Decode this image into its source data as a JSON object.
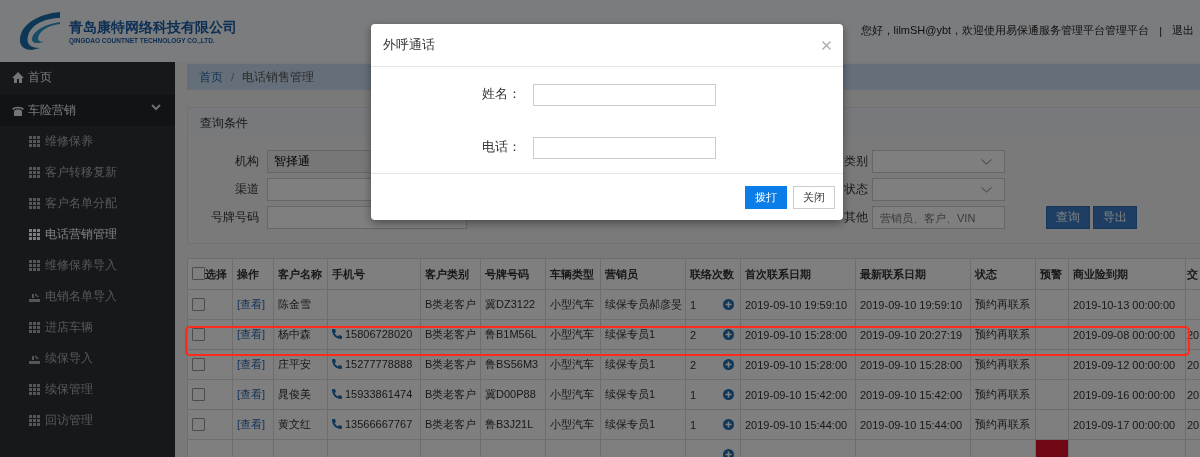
{
  "header": {
    "company_name": "青岛康特网络科技有限公司",
    "company_subtitle": "QINGDAO COUNTNET TECHNOLOGY CO.,LTD.",
    "greeting": "您好，lilmSH@ybt，欢迎使用易保通服务管理平台管理平台",
    "separator": "|",
    "logout": "退出"
  },
  "sidebar": {
    "items": [
      {
        "label": "首页",
        "kind": "home",
        "expanded": false
      },
      {
        "label": "车险营销",
        "kind": "phone",
        "expanded": true,
        "children": [
          {
            "label": "维修保养",
            "kind": "page",
            "selected": false
          },
          {
            "label": "客户转移复新",
            "kind": "page",
            "selected": false
          },
          {
            "label": "客户名单分配",
            "kind": "page",
            "selected": false
          },
          {
            "label": "电话营销管理",
            "kind": "page",
            "selected": true
          },
          {
            "label": "维修保养导入",
            "kind": "page",
            "selected": false
          },
          {
            "label": "电销名单导入",
            "kind": "upload",
            "selected": false
          },
          {
            "label": "进店车辆",
            "kind": "page",
            "selected": false
          },
          {
            "label": "续保导入",
            "kind": "upload",
            "selected": false
          },
          {
            "label": "续保管理",
            "kind": "page",
            "selected": false
          },
          {
            "label": "回访管理",
            "kind": "page",
            "selected": false
          }
        ]
      }
    ]
  },
  "breadcrumb": [
    {
      "label": "首页",
      "kind": "link"
    },
    {
      "label": "/",
      "kind": "separator"
    },
    {
      "label": "电话销售管理",
      "kind": "current"
    }
  ],
  "query_panel": {
    "title": "查询条件",
    "left_fields": [
      {
        "label": "机构",
        "value": "智择通"
      },
      {
        "label": "渠道"
      },
      {
        "label": "号牌号码"
      }
    ],
    "right_fields": [
      {
        "label": "类别",
        "kind": "select"
      },
      {
        "label": "状态",
        "kind": "select"
      },
      {
        "label": "其他",
        "kind": "input",
        "placeholder": "营销员、客户、VIN"
      }
    ],
    "buttons": [
      "查询",
      "导出"
    ]
  },
  "table": {
    "columns": [
      "选择",
      "操作",
      "客户名称",
      "手机号",
      "客户类别",
      "号牌号码",
      "车辆类型",
      "营销员",
      "联络次数",
      "首次联系日期",
      "最新联系日期",
      "状态",
      "预警",
      "商业险到期",
      "交"
    ],
    "rows": [
      {
        "checked": false,
        "highlighted": false,
        "warning": false,
        "action": "[查看]",
        "name": "陈金雪",
        "customer_type": "B类老客户",
        "plate": "冀DZ3122",
        "vehicle_type": "小型汽车",
        "salesperson": "续保专员郝彦旻",
        "contacts": "1",
        "first_contact": "2019-09-10 19:59:10",
        "last_contact": "2019-09-10 19:59:10",
        "status": "预约再联系",
        "insurance_expiry": "2019-10-13 00:00:00"
      },
      {
        "checked": false,
        "highlighted": true,
        "warning": false,
        "action": "[查看]",
        "name": "杨中森",
        "phone": "15806728020",
        "customer_type": "B类老客户",
        "plate": "鲁B1M56L",
        "vehicle_type": "小型汽车",
        "salesperson": "续保专员1",
        "contacts": "2",
        "first_contact": "2019-09-10 15:28:00",
        "last_contact": "2019-09-10 20:27:19",
        "status": "预约再联系",
        "insurance_expiry": "2019-09-08 00:00:00",
        "column_15": "20"
      },
      {
        "checked": false,
        "highlighted": false,
        "warning": false,
        "action": "[查看]",
        "name": "庄平安",
        "phone": "15277778888",
        "customer_type": "B类老客户",
        "plate": "鲁BS56M3",
        "vehicle_type": "小型汽车",
        "salesperson": "续保专员1",
        "contacts": "2",
        "first_contact": "2019-09-10 15:28:00",
        "last_contact": "2019-09-10 15:28:00",
        "status": "预约再联系",
        "insurance_expiry": "2019-09-12 00:00:00",
        "column_15": "20"
      },
      {
        "checked": false,
        "highlighted": false,
        "warning": false,
        "action": "[查看]",
        "name": "晁俊美",
        "phone": "15933861474",
        "customer_type": "B类老客户",
        "plate": "冀D00P88",
        "vehicle_type": "小型汽车",
        "salesperson": "续保专员1",
        "contacts": "1",
        "first_contact": "2019-09-10 15:42:00",
        "last_contact": "2019-09-10 15:42:00",
        "status": "预约再联系",
        "insurance_expiry": "2019-09-16 00:00:00",
        "column_15": "20"
      },
      {
        "checked": false,
        "highlighted": false,
        "warning": false,
        "action": "[查看]",
        "name": "黄文红",
        "phone": "13566667767",
        "customer_type": "B类老客户",
        "plate": "鲁B3J21L",
        "vehicle_type": "小型汽车",
        "salesperson": "续保专员1",
        "contacts": "1",
        "first_contact": "2019-09-10 15:44:00",
        "last_contact": "2019-09-10 15:44:00",
        "status": "预约再联系",
        "insurance_expiry": "2019-09-17 00:00:00",
        "column_15": "20"
      },
      {
        "highlighted": false,
        "warning": true
      }
    ]
  },
  "modal": {
    "title": "外呼通话",
    "fields": [
      {
        "label": "姓名："
      },
      {
        "label": "电话："
      }
    ],
    "buttons": [
      {
        "label": "拨打",
        "kind": "primary"
      },
      {
        "label": "关闭",
        "kind": "default"
      }
    ]
  }
}
